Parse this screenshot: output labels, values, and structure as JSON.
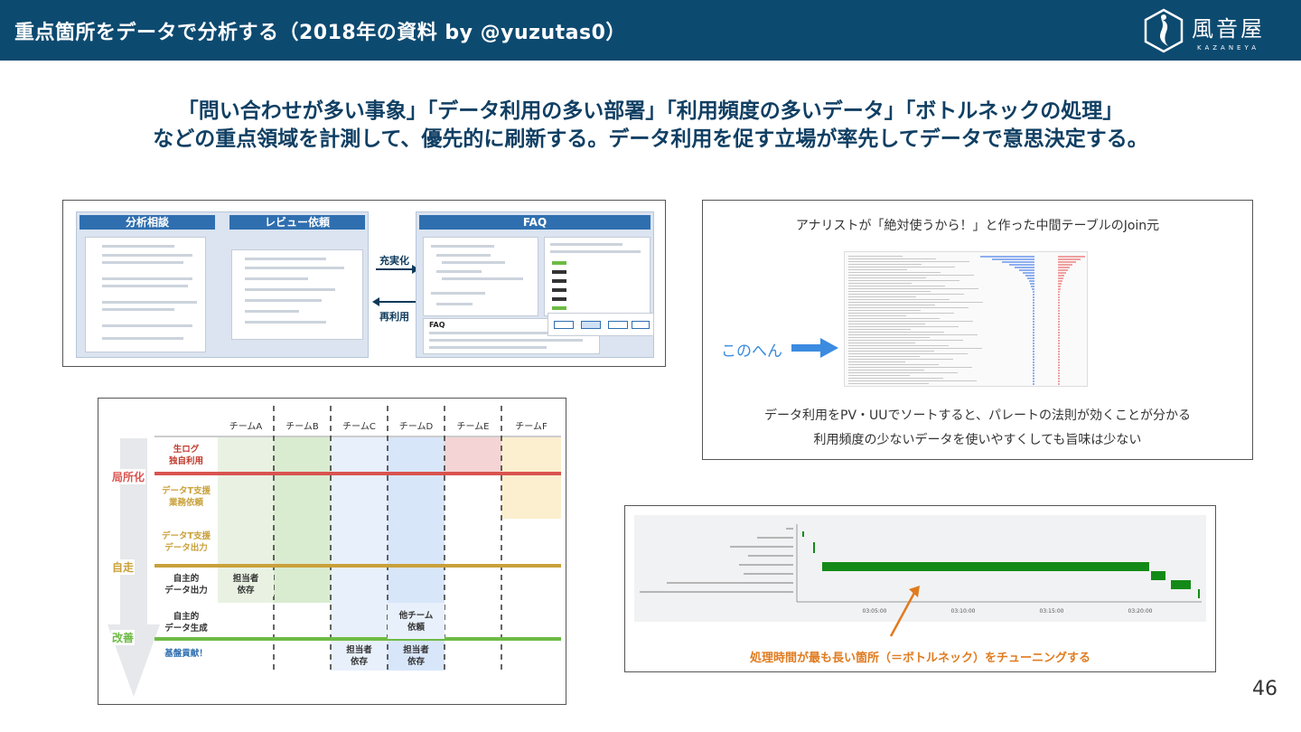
{
  "header": {
    "title": "重点箇所をデータで分析する（2018年の資料 by @yuzutas0）",
    "logo_jp": "風音屋",
    "logo_en": "KAZANEYA",
    "bg_color": "#0d4a70"
  },
  "headline": {
    "line1": "「問い合わせが多い事象」「データ利用の多い部署」「利用頻度の多いデータ」「ボトルネックの処理」",
    "line2": "などの重点領域を計測して、優先的に刷新する。データ利用を促す立場が率先してデータで意思決定する。"
  },
  "panel1": {
    "col1": "分析相談",
    "col2": "レビュー依頼",
    "col3": "FAQ",
    "arrow_right": "充実化",
    "arrow_left": "再利用",
    "faq_box": "FAQ"
  },
  "panel2": {
    "caption_top": "アナリストが「絶対使うから！」と作った中間テーブルのJoin元",
    "pointer": "このへん",
    "caption_bottom1": "データ利用をPV・UUでソートすると、パレートの法則が効くことが分かる",
    "caption_bottom2": "利用頻度の少ないデータを使いやすくしても旨味は少ない"
  },
  "panel3": {
    "teams": [
      "チームA",
      "チームB",
      "チームC",
      "チームD",
      "チームE",
      "チームF"
    ],
    "rows": [
      "生ログ\n独自利用",
      "データT支援\n業務依頼",
      "データT支援\nデータ出力",
      "自主的\nデータ出力",
      "自主的\nデータ生成",
      "基盤貢献！"
    ],
    "levels": [
      "局所化",
      "自走",
      "改善"
    ],
    "cell_a4": "担当者\n依存",
    "cell_d5": "他チーム\n依頼",
    "cell_c6": "担当者\n依存",
    "cell_d6": "担当者\n依存",
    "colors": {
      "red": "#d9534f",
      "gold": "#c9a13b",
      "green": "#6dbb45"
    }
  },
  "panel4": {
    "caption": "処理時間が最も長い箇所（＝ボトルネック）をチューニングする",
    "ticks": [
      "03:05:00",
      "03:10:00",
      "03:15:00",
      "03:20:00"
    ],
    "bar_color": "#138a17"
  },
  "page_number": "46"
}
